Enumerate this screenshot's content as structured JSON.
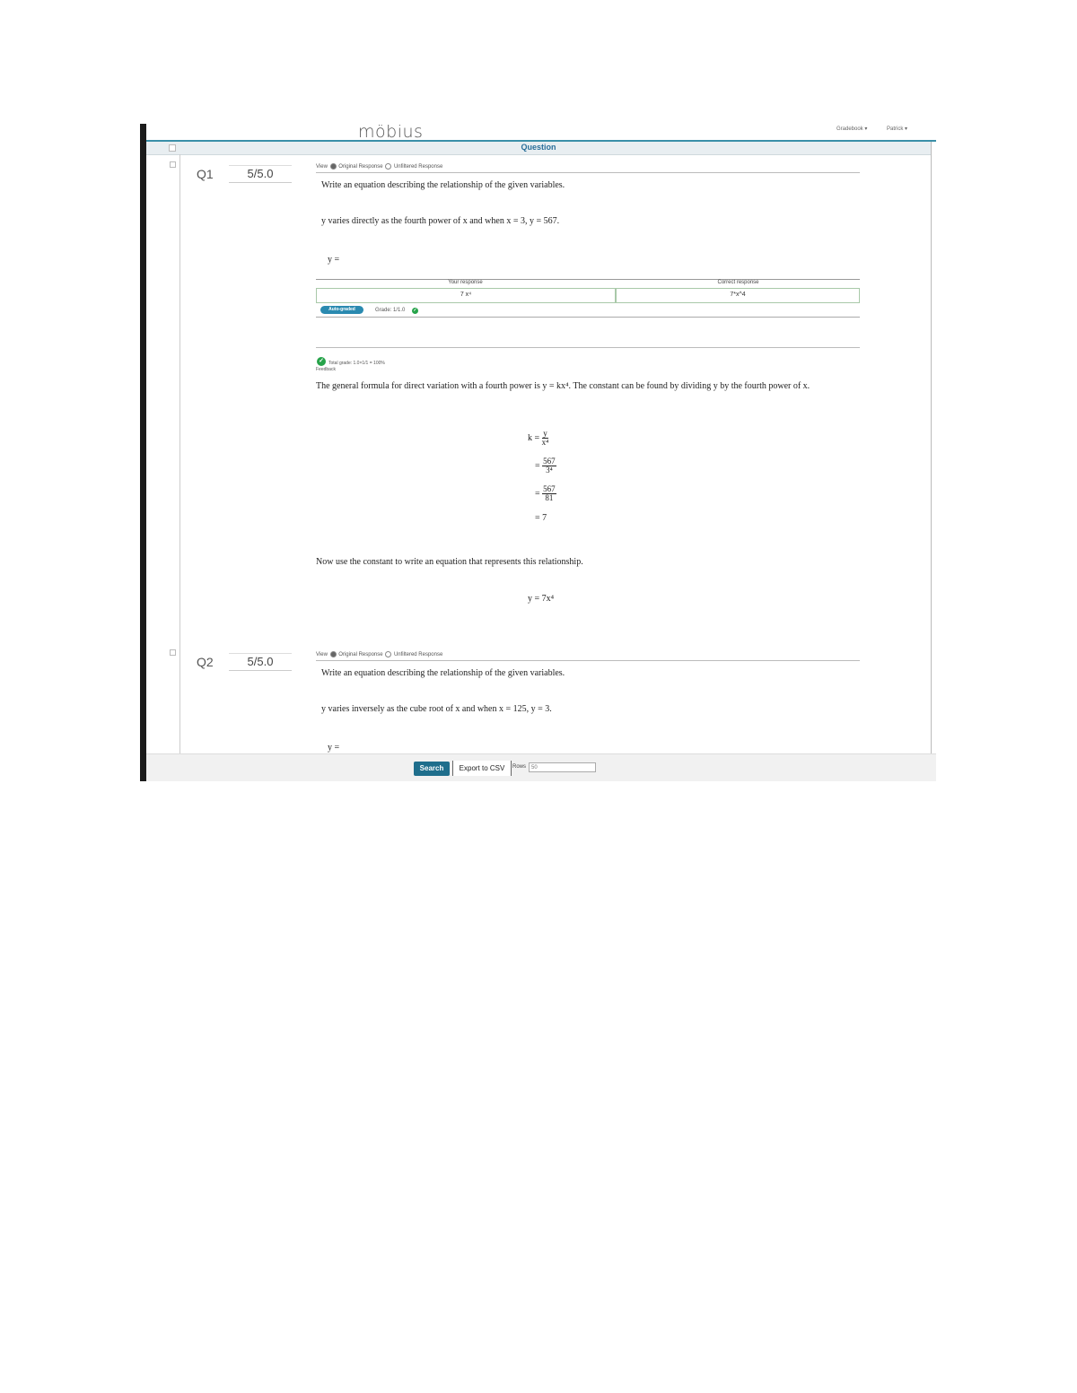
{
  "app": {
    "logo": "möbius",
    "nav_left": "Gradebook ▾",
    "nav_right": "Patrick ▾"
  },
  "table": {
    "header_title": "Question"
  },
  "questions": [
    {
      "num": "Q1",
      "grade": "5/5.0",
      "view_label": "View",
      "view_original": "Original Response",
      "view_unfiltered": "Unfiltered Response",
      "prompt": "Write an equation describing the relationship of the given variables.",
      "statement": "y varies directly as the fourth power of x and when x = 3, y = 567.",
      "answer_label": "y =",
      "your_response_header": "Your response",
      "correct_response_header": "Correct response",
      "your_response": "7 x⁴",
      "correct_response": "7*x^4",
      "auto_graded": "Auto-graded",
      "grade_line": "Grade: 1/1.0",
      "total_grade": "Total grade: 1.0×1/1 = 100%",
      "feedback_label": "Feedback",
      "feedback_text": "The general formula for direct variation with a fourth power is y = kx⁴. The constant can be found by dividing y by the fourth power of x.",
      "steps": {
        "k": "k =",
        "eq": "=",
        "n1": "y",
        "d1": "x⁴",
        "n2": "567",
        "d2": "3⁴",
        "n3": "567",
        "d3": "81",
        "final": "= 7"
      },
      "conclusion": "Now use the constant to write an equation that represents this relationship.",
      "final_equation": "y = 7x⁴"
    },
    {
      "num": "Q2",
      "grade": "5/5.0",
      "view_label": "View",
      "view_original": "Original Response",
      "view_unfiltered": "Unfiltered Response",
      "prompt": "Write an equation describing the relationship of the given variables.",
      "statement": "y varies inversely as the cube root of x and when x = 125, y = 3.",
      "answer_label": "y ="
    }
  ],
  "footer": {
    "search_label": "Search",
    "export_label": "Export to CSV",
    "rows_label": "Rows",
    "rows_value": "50"
  }
}
